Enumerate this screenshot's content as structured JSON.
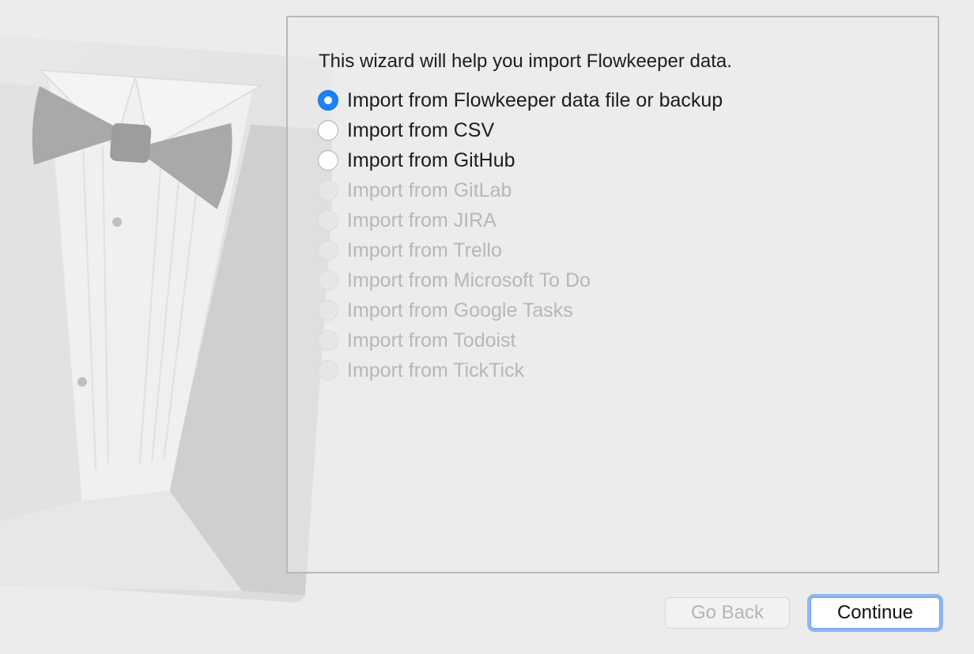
{
  "wizard": {
    "intro": "This wizard will help you import Flowkeeper data.",
    "options": [
      {
        "label": "Import from Flowkeeper data file or backup",
        "checked": true,
        "enabled": true
      },
      {
        "label": "Import from CSV",
        "checked": false,
        "enabled": true
      },
      {
        "label": "Import from GitHub",
        "checked": false,
        "enabled": true
      },
      {
        "label": "Import from GitLab",
        "checked": false,
        "enabled": false
      },
      {
        "label": "Import from JIRA",
        "checked": false,
        "enabled": false
      },
      {
        "label": "Import from Trello",
        "checked": false,
        "enabled": false
      },
      {
        "label": "Import from Microsoft To Do",
        "checked": false,
        "enabled": false
      },
      {
        "label": "Import from Google Tasks",
        "checked": false,
        "enabled": false
      },
      {
        "label": "Import from Todoist",
        "checked": false,
        "enabled": false
      },
      {
        "label": "Import from TickTick",
        "checked": false,
        "enabled": false
      }
    ]
  },
  "buttons": {
    "back_label": "Go Back",
    "continue_label": "Continue"
  },
  "colors": {
    "accent": "#1a83fb",
    "focus_ring": "#8fb6f3"
  },
  "icons": {
    "wizard_art": "tuxedo-bowtie-illustration"
  }
}
